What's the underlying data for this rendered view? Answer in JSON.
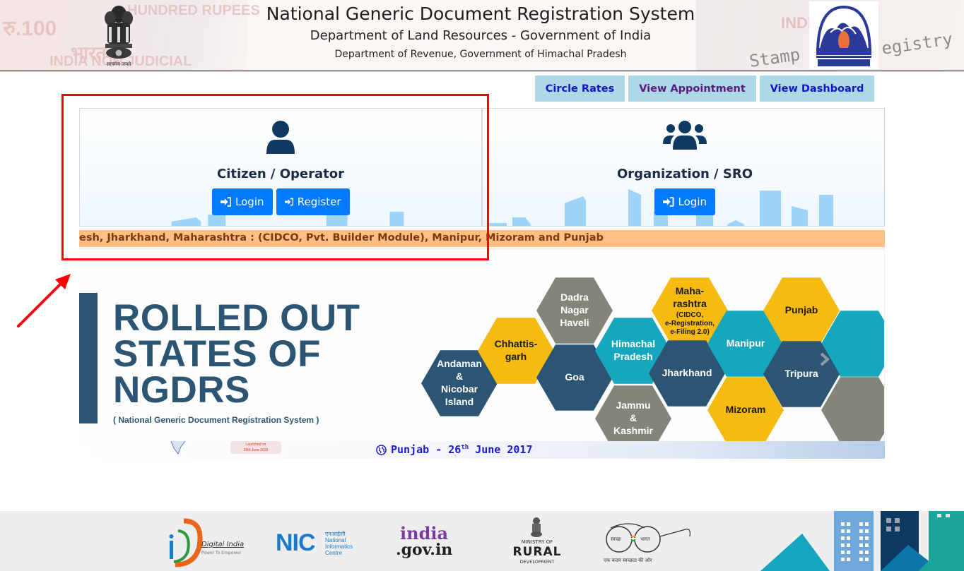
{
  "header": {
    "title": "National Generic Document Registration System",
    "subtitle": "Department of Land Resources - Government of India",
    "subtitle2": "Department of Revenue, Government of Himachal Pradesh",
    "emblem_caption": "सत्यमेव जयते",
    "stamp_left_text_1": "रु.100",
    "stamp_left_text_2": "HUNDRED RUPEES",
    "stamp_left_text_3": "भारत",
    "stamp_left_text_4": "INDIA NON JUDICIAL",
    "stamp_right_text_1": "INDIA",
    "stamp_right_text_2": "Stamp",
    "stamp_right_text_3": "egistry"
  },
  "top_links": [
    {
      "label": "Circle Rates"
    },
    {
      "label": "View Appointment"
    },
    {
      "label": "View Dashboard"
    }
  ],
  "panels": {
    "citizen": {
      "title": "Citizen / Operator",
      "login_label": "Login",
      "register_label": "Register"
    },
    "organization": {
      "title": "Organization / SRO",
      "login_label": "Login"
    }
  },
  "marquee": {
    "text": "esh, Jharkhand, Maharashtra : (CIDCO, Pvt. Builder Module), Manipur, Mizoram and Punjab"
  },
  "banner": {
    "title_line1": "ROLLED OUT",
    "title_line2": "STATES OF",
    "title_line3": "NGDRS",
    "subtitle": "( National Generic Document Registration System )",
    "states": [
      {
        "name": [
          "Andaman",
          "&",
          "Nicobar",
          "Island"
        ],
        "color": "#2c5573",
        "text_color": "#ffffff"
      },
      {
        "name": [
          "Chhattis-",
          "garh"
        ],
        "color": "#f5bb10",
        "text_color": "#1a1a1a"
      },
      {
        "name": [
          "Dadra",
          "Nagar",
          "Haveli"
        ],
        "color": "#85847a",
        "text_color": "#ffffff"
      },
      {
        "name": [
          "Goa"
        ],
        "color": "#2c5573",
        "text_color": "#ffffff"
      },
      {
        "name": [
          "Himachal",
          "Pradesh"
        ],
        "color": "#16a7bf",
        "text_color": "#ffffff"
      },
      {
        "name": [
          "Jammu",
          "&",
          "Kashmir"
        ],
        "color": "#85847a",
        "text_color": "#ffffff"
      },
      {
        "name": [
          "Maha-",
          "rashtra"
        ],
        "note": [
          "(CIDCO,",
          "e-Registration,",
          "e-Filing 2.0)"
        ],
        "color": "#f5bb10",
        "text_color": "#1a1a1a"
      },
      {
        "name": [
          "Jharkhand"
        ],
        "color": "#2c5573",
        "text_color": "#ffffff"
      },
      {
        "name": [
          "Manipur"
        ],
        "color": "#16a7bf",
        "text_color": "#ffffff"
      },
      {
        "name": [
          "Mizoram"
        ],
        "color": "#f5bb10",
        "text_color": "#1a1a1a"
      },
      {
        "name": [
          "Punjab"
        ],
        "color": "#f5bb10",
        "text_color": "#1a1a1a"
      },
      {
        "name": [
          "Tripura"
        ],
        "color": "#2c5573",
        "text_color": "#ffffff"
      }
    ]
  },
  "ticker": {
    "launched_label": "Launched on",
    "launched_date": "29th June 2018",
    "text_main": "Punjab - 26",
    "text_sup": "th",
    "text_tail": "June 2017"
  },
  "footer": {
    "logos": [
      {
        "name": "Digital India",
        "tagline": "Power To Empower"
      },
      {
        "name": "NIC",
        "hindi": "एनआईसी",
        "full": [
          "National",
          "Informatics",
          "Centre"
        ]
      },
      {
        "name_top": "india",
        "name_bottom": ".gov.in"
      },
      {
        "line1": "MINISTRY OF",
        "line2": "RURAL",
        "line3": "DEVELOPMENT"
      },
      {
        "left": "स्वच्छ",
        "right": "भारत",
        "tagline": "एक कदम स्वच्छता की ओर"
      }
    ]
  },
  "colors": {
    "primary_button": "#007bff",
    "top_link_bg": "#add8e6",
    "marquee_bg": "#ffbe82",
    "banner_navy": "#2c5573",
    "annotation_red": "#ff0000"
  }
}
